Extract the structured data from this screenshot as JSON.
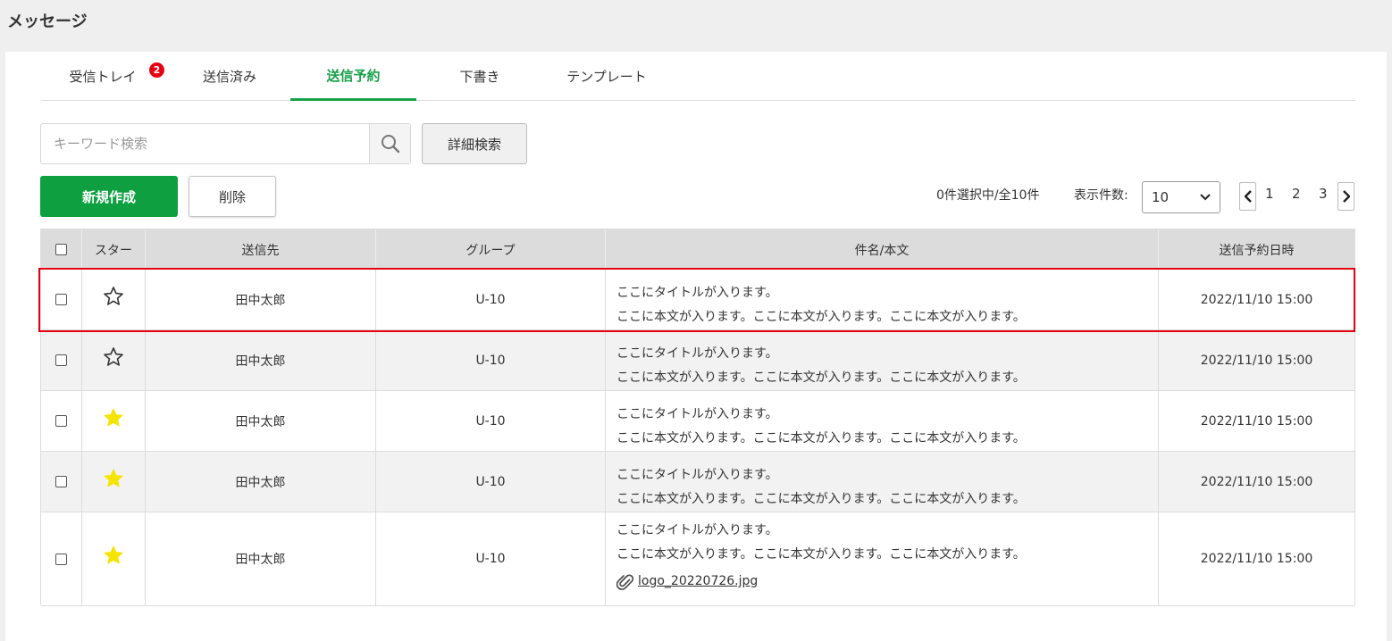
{
  "page": {
    "title": "メッセージ"
  },
  "tabs": [
    {
      "label": "受信トレイ",
      "badge": "2"
    },
    {
      "label": "送信済み"
    },
    {
      "label": "送信予約",
      "active": true
    },
    {
      "label": "下書き"
    },
    {
      "label": "テンプレート"
    }
  ],
  "search": {
    "placeholder": "キーワード検索",
    "value": ""
  },
  "buttons": {
    "detail_search": "詳細検索",
    "new": "新規作成",
    "delete": "削除"
  },
  "status": {
    "selection": "0件選択中/全10件",
    "per_page_label": "表示件数:",
    "per_page_value": "10"
  },
  "pagination": {
    "pages": [
      "1",
      "2",
      "3"
    ]
  },
  "table": {
    "headers": [
      "スター",
      "送信先",
      "グループ",
      "件名/本文",
      "送信予約日時"
    ],
    "rows": [
      {
        "starred": false,
        "recipient": "田中太郎",
        "group": "U-10",
        "subject": "ここにタイトルが入ります。",
        "body": "ここに本文が入ります。ここに本文が入ります。ここに本文が入ります。",
        "datetime": "2022/11/10 15:00"
      },
      {
        "starred": false,
        "recipient": "田中太郎",
        "group": "U-10",
        "subject": "ここにタイトルが入ります。",
        "body": "ここに本文が入ります。ここに本文が入ります。ここに本文が入ります。",
        "datetime": "2022/11/10 15:00"
      },
      {
        "starred": true,
        "recipient": "田中太郎",
        "group": "U-10",
        "subject": "ここにタイトルが入ります。",
        "body": "ここに本文が入ります。ここに本文が入ります。ここに本文が入ります。",
        "datetime": "2022/11/10 15:00"
      },
      {
        "starred": true,
        "recipient": "田中太郎",
        "group": "U-10",
        "subject": "ここにタイトルが入ります。",
        "body": "ここに本文が入ります。ここに本文が入ります。ここに本文が入ります。",
        "datetime": "2022/11/10 15:00"
      },
      {
        "starred": true,
        "recipient": "田中太郎",
        "group": "U-10",
        "subject": "ここにタイトルが入ります。",
        "body": "ここに本文が入ります。ここに本文が入ります。ここに本文が入ります。",
        "datetime": "2022/11/10 15:00",
        "attachment": "logo_20220726.jpg"
      }
    ]
  },
  "colors": {
    "accent": "#19a04a",
    "primary_button": "#0e9f41",
    "badge": "#e60012",
    "star_filled": "#f5e400",
    "highlight": "#e60012"
  },
  "icons": {
    "search": "search-icon",
    "star_empty": "star-outline-icon",
    "star_filled": "star-filled-icon",
    "attachment": "paperclip-icon",
    "chevron_left": "chevron-left-icon",
    "chevron_right": "chevron-right-icon",
    "dropdown": "chevron-down-icon"
  }
}
